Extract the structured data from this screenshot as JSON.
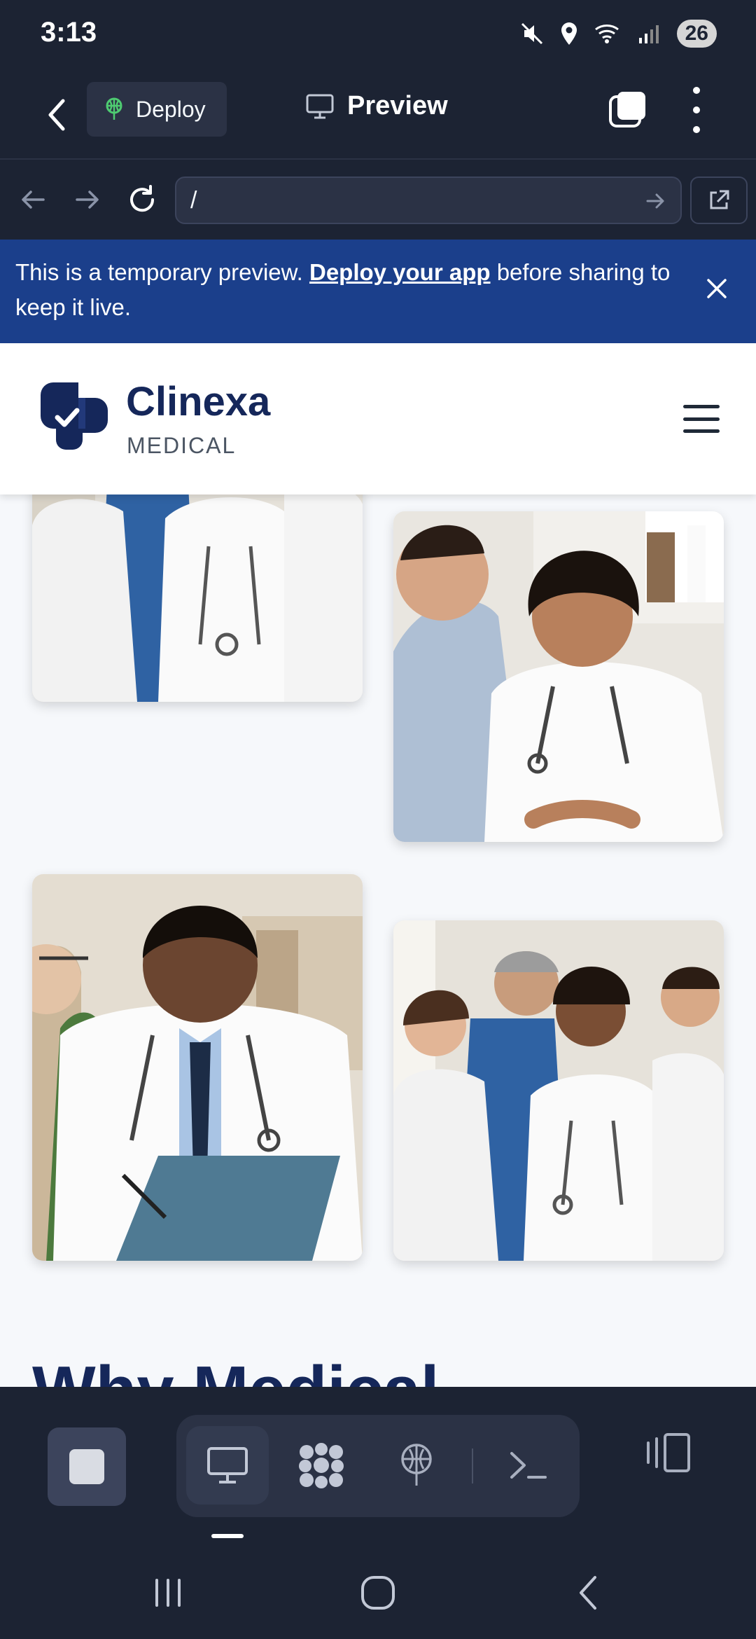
{
  "status_bar": {
    "time": "3:13",
    "battery": "26"
  },
  "top_bar": {
    "deploy_label": "Deploy",
    "preview_label": "Preview"
  },
  "url_bar": {
    "url_value": "/"
  },
  "banner": {
    "text_before": "This is a temporary preview. ",
    "link_text": "Deploy your app",
    "text_after": " before sharing to keep it live."
  },
  "site": {
    "brand_name": "Clinexa",
    "brand_sub": "MEDICAL",
    "section_heading": "Why Medical"
  },
  "photos": [
    {
      "name": "team-photo",
      "subject": "medical team group"
    },
    {
      "name": "consultation-photo",
      "subject": "doctor consulting patient"
    },
    {
      "name": "doctor-clipboard-photo",
      "subject": "doctor writing on clipboard"
    },
    {
      "name": "team-photo-2",
      "subject": "medical team group"
    }
  ],
  "toolbar": {
    "tools": [
      "preview-tool",
      "apps-tool",
      "deploy-tool",
      "console-tool"
    ],
    "active_tool": "preview-tool"
  },
  "colors": {
    "app_bg": "#1c2333",
    "banner_bg": "#1b3f8b",
    "brand_navy": "#15275a",
    "page_bg": "#f6f8fb"
  }
}
